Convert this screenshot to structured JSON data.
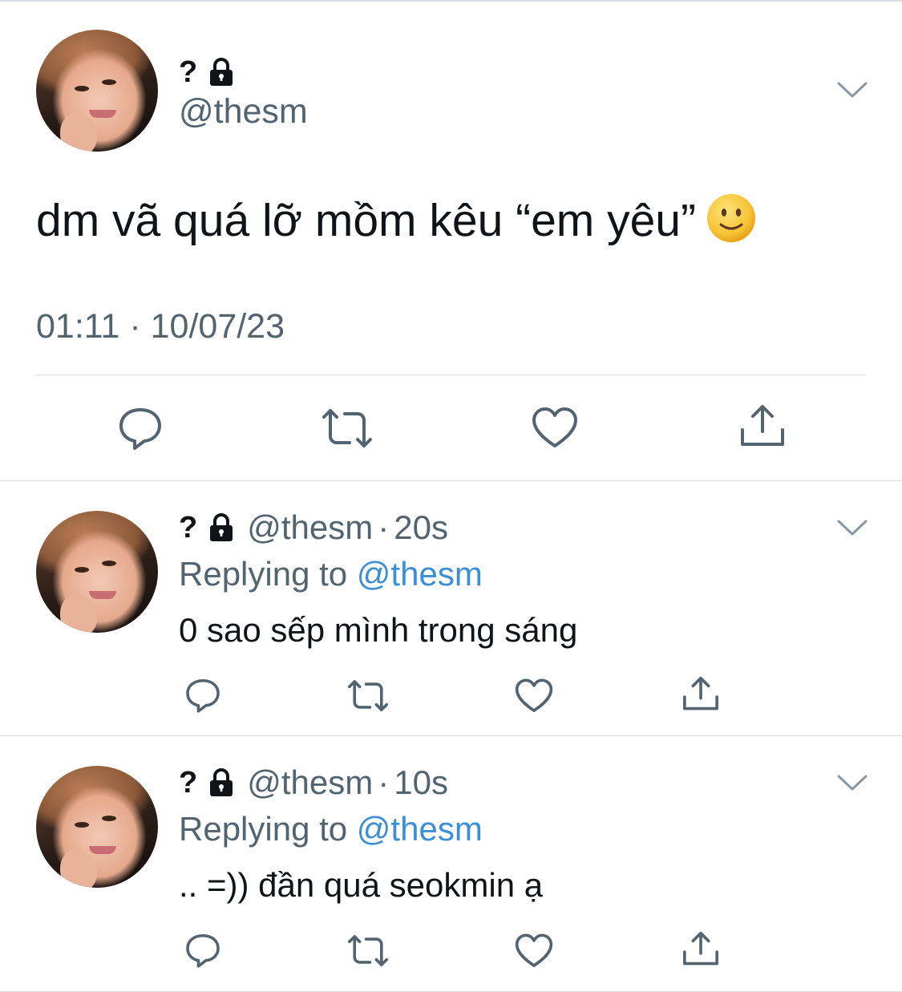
{
  "main_tweet": {
    "display_name": "?",
    "handle": "@thesm",
    "text": "dm vã quá lỡ mồm kêu “em yêu”",
    "emoji": "slightly-smiling-face-emoji",
    "timestamp": "01:11 · 10/07/23",
    "actions": [
      "reply-icon",
      "retweet-icon",
      "like-icon",
      "share-icon"
    ]
  },
  "replies": [
    {
      "display_name": "?",
      "handle": "@thesm",
      "separator": "·",
      "time": "20s",
      "replying_prefix": "Replying to",
      "replying_to": "@thesm",
      "text": "0 sao sếp mình trong sáng"
    },
    {
      "display_name": "?",
      "handle": "@thesm",
      "separator": "·",
      "time": "10s",
      "replying_prefix": "Replying to",
      "replying_to": "@thesm",
      "text": ".. =)) đần quá seokmin ạ"
    }
  ],
  "colors": {
    "text_primary": "#0f1419",
    "text_secondary": "#536471",
    "mention": "#3a8fd6",
    "divider": "#d9dde1",
    "icon": "#536471"
  }
}
